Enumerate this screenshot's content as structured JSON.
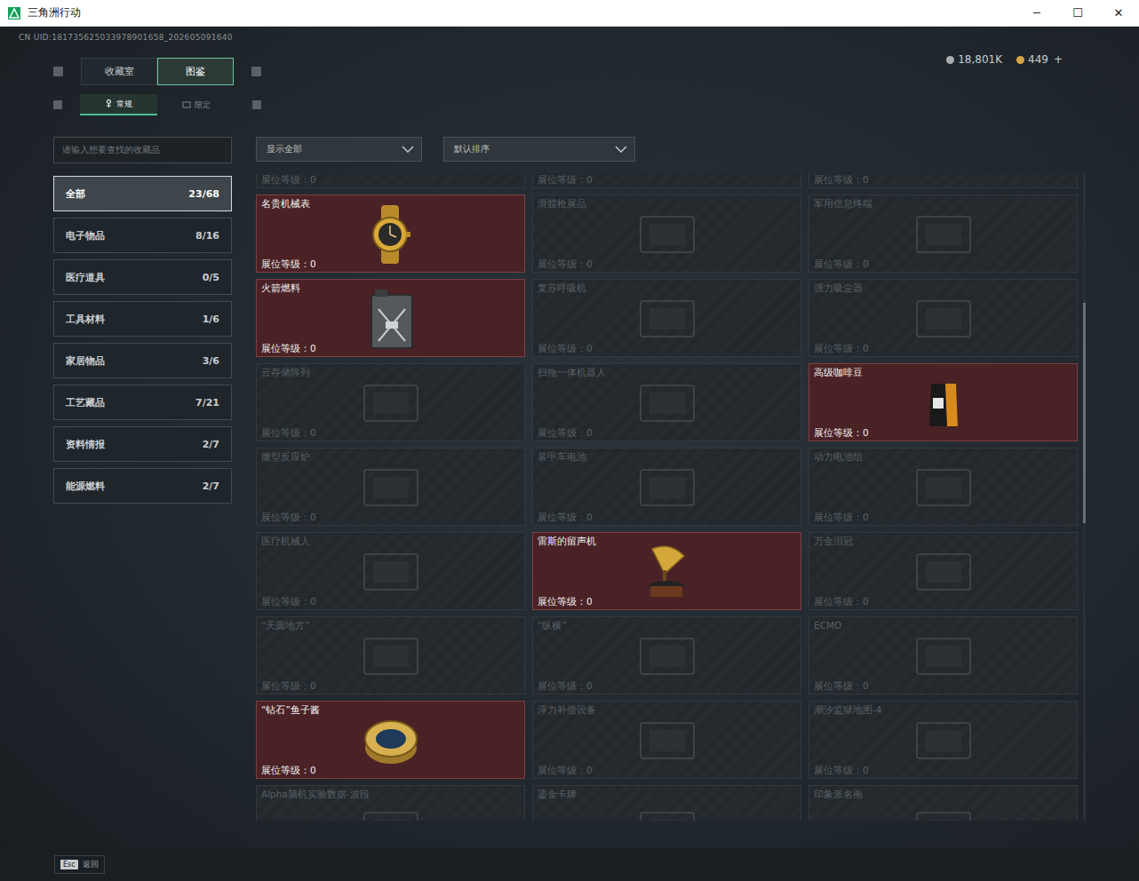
{
  "window": {
    "title": "三角洲行动",
    "controls": [
      "─",
      "☐",
      "✕"
    ]
  },
  "uid": "CN UID:181735625033978901658_202605091640",
  "currency": [
    {
      "amount": "18,801K",
      "color": "#a9adb1"
    },
    {
      "amount": "449",
      "color": "#d9a548"
    }
  ],
  "currency_add": "+",
  "tabs": [
    {
      "label": "收藏室",
      "selected": false
    },
    {
      "label": "图鉴",
      "selected": true
    }
  ],
  "subtabs": [
    {
      "label": "常规",
      "selected": true
    },
    {
      "label": "限定",
      "selected": false
    }
  ],
  "search": {
    "placeholder": "请输入想要查找的收藏品"
  },
  "categories": [
    {
      "label": "全部",
      "count": "23/68",
      "selected": true
    },
    {
      "label": "电子物品",
      "count": "8/16",
      "selected": false
    },
    {
      "label": "医疗道具",
      "count": "0/5",
      "selected": false
    },
    {
      "label": "工具材料",
      "count": "1/6",
      "selected": false
    },
    {
      "label": "家居物品",
      "count": "3/6",
      "selected": false
    },
    {
      "label": "工艺藏品",
      "count": "7/21",
      "selected": false
    },
    {
      "label": "资料情报",
      "count": "2/7",
      "selected": false
    },
    {
      "label": "能源燃料",
      "count": "2/7",
      "selected": false
    }
  ],
  "filters": [
    {
      "label": "显示全部"
    },
    {
      "label": "默认排序"
    }
  ],
  "top_partial": [
    {
      "level_label": "展位等级：0",
      "collected": false
    },
    {
      "level_label": "展位等级：0",
      "collected": false
    },
    {
      "level_label": "展位等级：0",
      "collected": false
    }
  ],
  "items": [
    {
      "name": "名贵机械表",
      "level_label": "展位等级：0",
      "collected": true,
      "kind": "watch"
    },
    {
      "name": "滑膛枪展品",
      "level_label": "展位等级：0",
      "collected": false,
      "kind": "placeholder"
    },
    {
      "name": "军用信息终端",
      "level_label": "展位等级：0",
      "collected": false,
      "kind": "placeholder"
    },
    {
      "name": "火箭燃料",
      "level_label": "展位等级：0",
      "collected": true,
      "kind": "fuel"
    },
    {
      "name": "复苏呼吸机",
      "level_label": "展位等级：0",
      "collected": false,
      "kind": "placeholder"
    },
    {
      "name": "强力吸尘器",
      "level_label": "展位等级：0",
      "collected": false,
      "kind": "placeholder"
    },
    {
      "name": "云存储阵列",
      "level_label": "展位等级：0",
      "collected": false,
      "kind": "placeholder"
    },
    {
      "name": "扫拖一体机器人",
      "level_label": "展位等级：0",
      "collected": false,
      "kind": "placeholder"
    },
    {
      "name": "高级咖啡豆",
      "level_label": "展位等级：0",
      "collected": true,
      "kind": "coffee"
    },
    {
      "name": "微型反应炉",
      "level_label": "展位等级：0",
      "collected": false,
      "kind": "placeholder"
    },
    {
      "name": "装甲车电池",
      "level_label": "展位等级：0",
      "collected": false,
      "kind": "placeholder"
    },
    {
      "name": "动力电池组",
      "level_label": "展位等级：0",
      "collected": false,
      "kind": "placeholder"
    },
    {
      "name": "医疗机械人",
      "level_label": "展位等级：0",
      "collected": false,
      "kind": "placeholder"
    },
    {
      "name": "雷斯的留声机",
      "level_label": "展位等级：0",
      "collected": true,
      "kind": "gramophone"
    },
    {
      "name": "万金泪冠",
      "level_label": "展位等级：0",
      "collected": false,
      "kind": "placeholder"
    },
    {
      "name": "“天圆地方”",
      "level_label": "展位等级：0",
      "collected": false,
      "kind": "placeholder"
    },
    {
      "name": "“纵横”",
      "level_label": "展位等级：0",
      "collected": false,
      "kind": "placeholder"
    },
    {
      "name": "ECMO",
      "level_label": "展位等级：0",
      "collected": false,
      "kind": "placeholder"
    },
    {
      "name": "“钻石”鱼子酱",
      "level_label": "展位等级：0",
      "collected": true,
      "kind": "caviar"
    },
    {
      "name": "浮力补偿设备",
      "level_label": "展位等级：0",
      "collected": false,
      "kind": "placeholder"
    },
    {
      "name": "潮汐监狱地图-4",
      "level_label": "展位等级：0",
      "collected": false,
      "kind": "placeholder"
    },
    {
      "name": "Alpha脑机实验数据-波段",
      "level_label": "",
      "collected": false,
      "kind": "placeholder"
    },
    {
      "name": "鎏金卡牌",
      "level_label": "",
      "collected": false,
      "kind": "placeholder"
    },
    {
      "name": "印象派名画",
      "level_label": "",
      "collected": false,
      "kind": "placeholder"
    }
  ],
  "scrollbar": {
    "start": 0.2,
    "size": 0.34
  },
  "footer": {
    "key": "Esc",
    "label": "返回"
  }
}
